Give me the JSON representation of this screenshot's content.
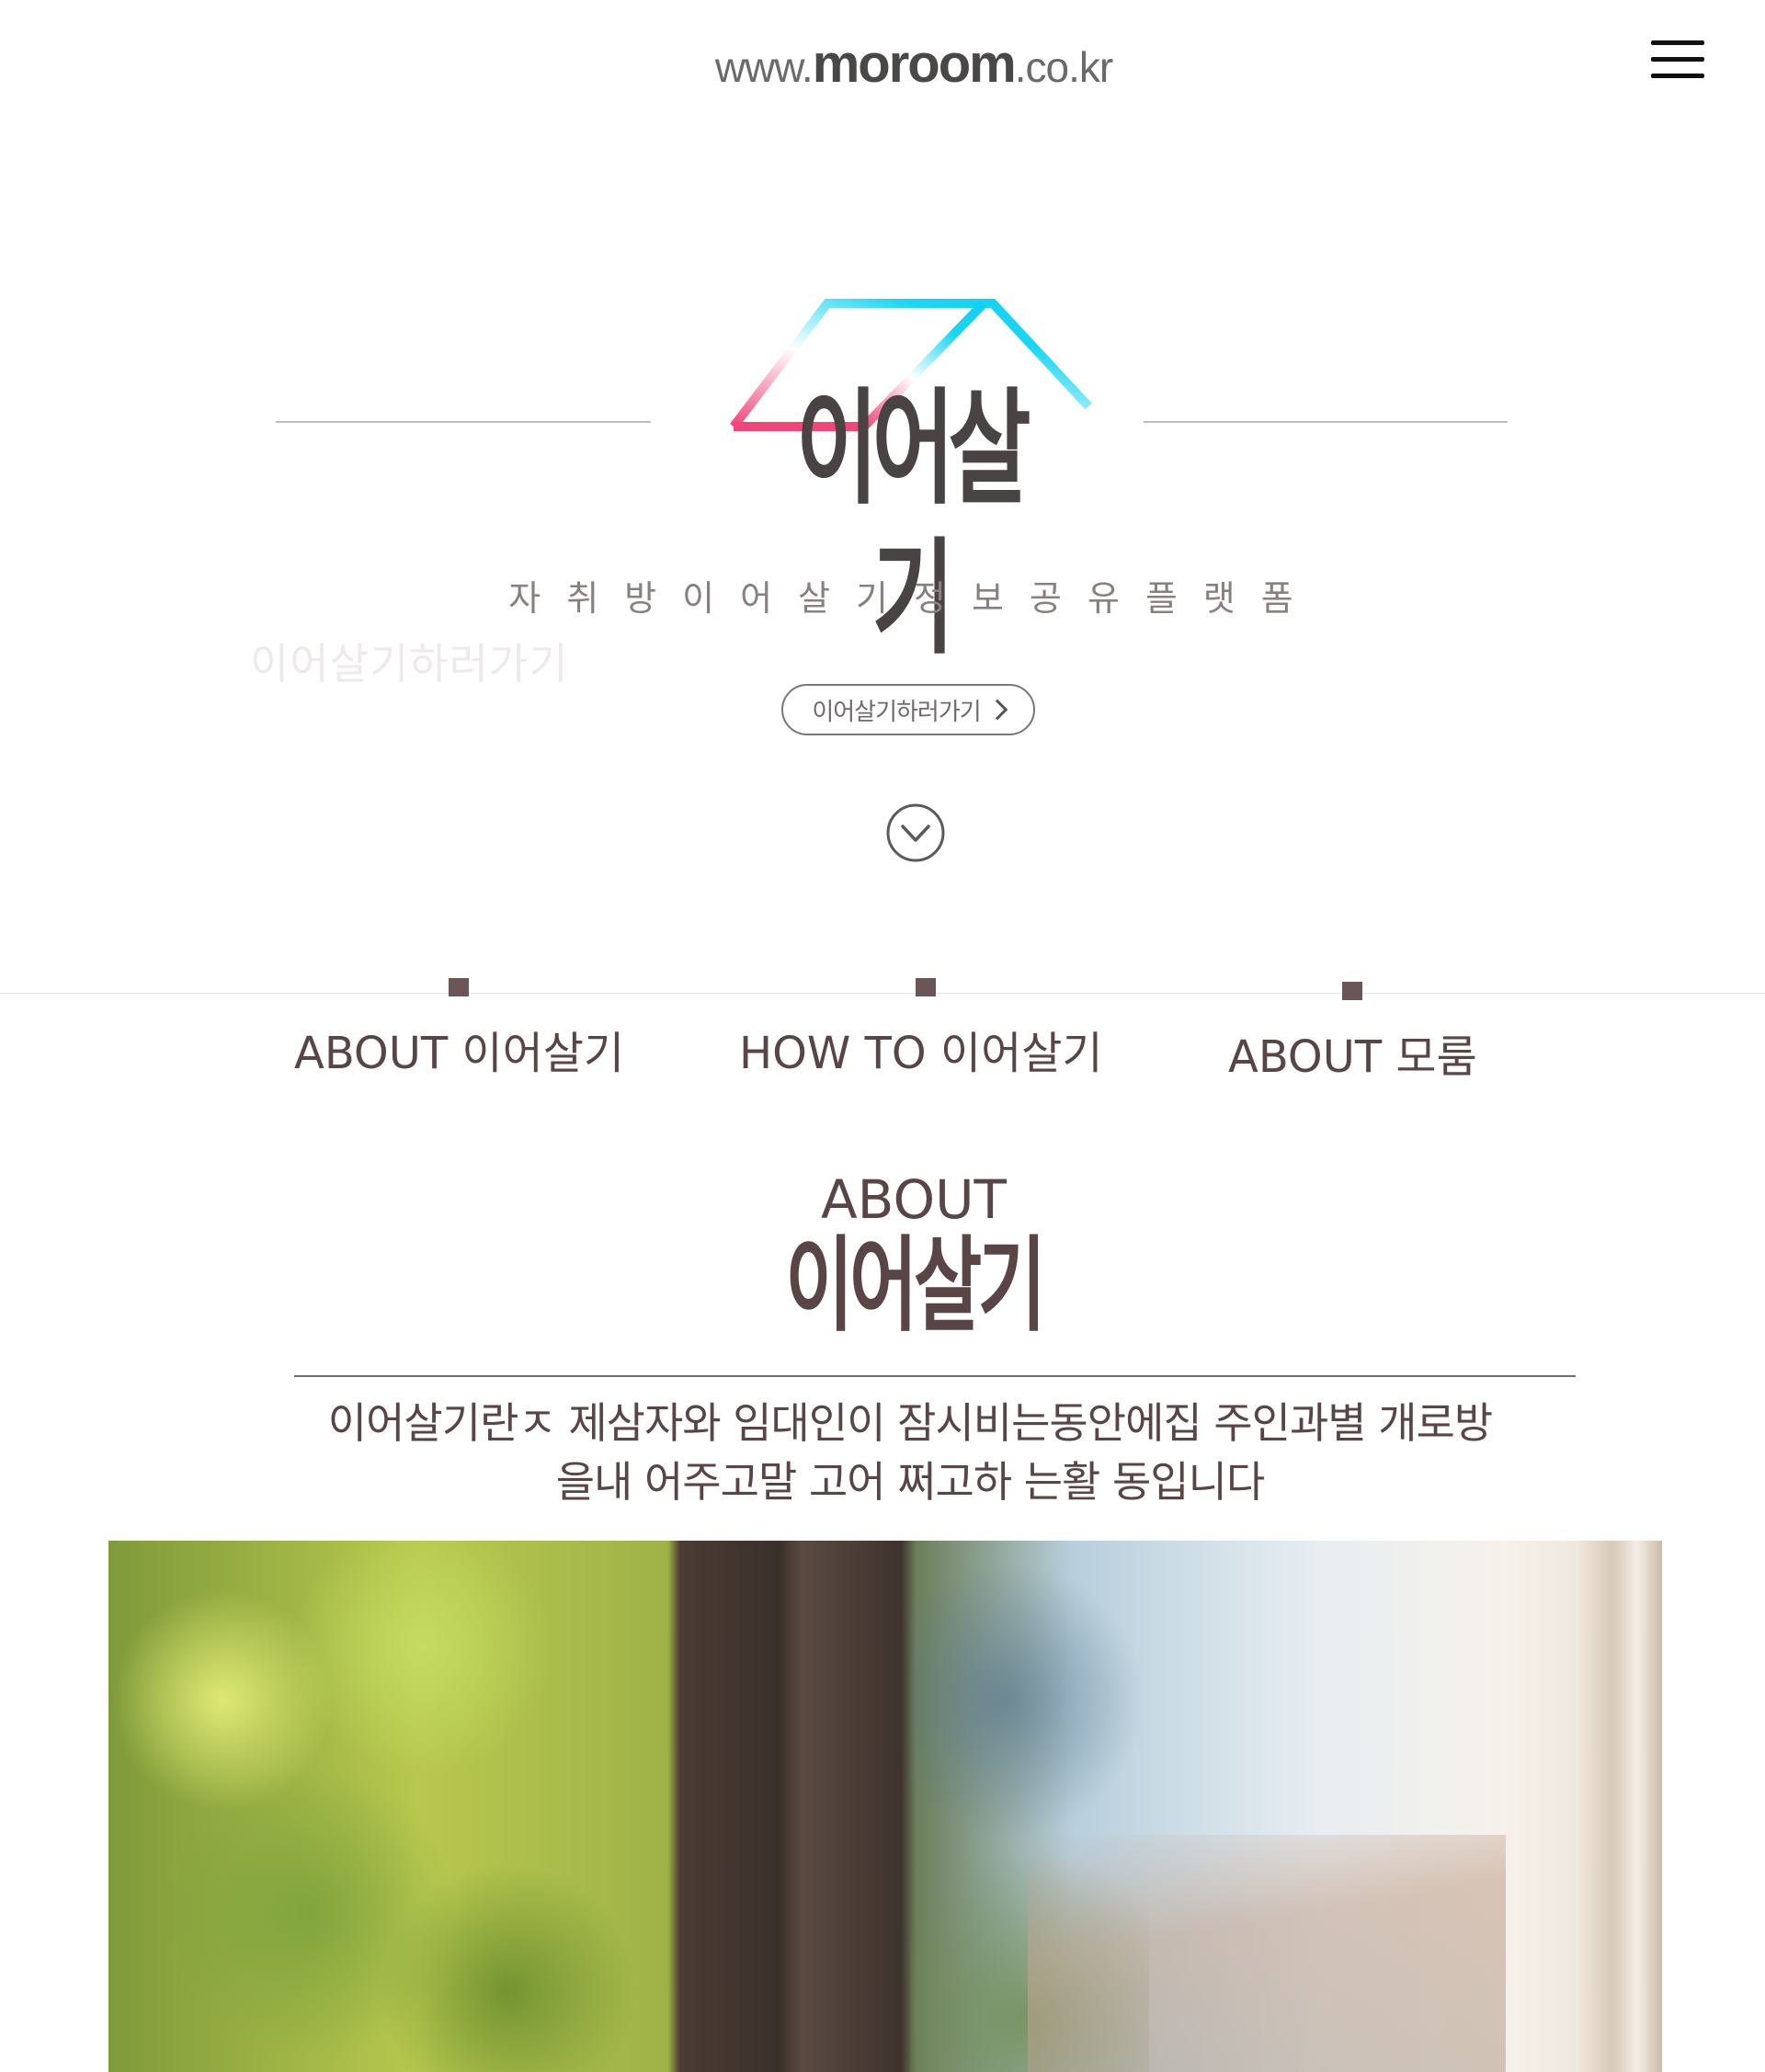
{
  "header": {
    "url_prefix": "www.",
    "url_brand": "moroom",
    "url_suffix": ".co.kr",
    "menu_icon": "hamburger-icon"
  },
  "hero": {
    "logo_text": "이어살기",
    "tagline": "자취방이어살기정보공유플랫폼",
    "ghost_cta": "이어살기하러가기",
    "cta_label": "이어살기하러가기",
    "scroll_icon": "chevron-down-circle-icon",
    "roof_colors": {
      "cyan": "#1ad6f2",
      "pink": "#f0467a"
    }
  },
  "tabs": [
    {
      "label": "ABOUT 이어살기"
    },
    {
      "label": "HOW TO  이어살기"
    },
    {
      "label": "ABOUT 모룸"
    }
  ],
  "about": {
    "heading": "ABOUT",
    "title": "이어살기",
    "description_line1": "이어살기란ㅈ 제삼자와 임대인이 잠시비는동안에집 주인과별 개로방",
    "description_line2": "을내 어주고말 고어 쩌고하 는활 동입니다"
  },
  "colors": {
    "text": "#5a4546",
    "accent": "#6b5556"
  }
}
